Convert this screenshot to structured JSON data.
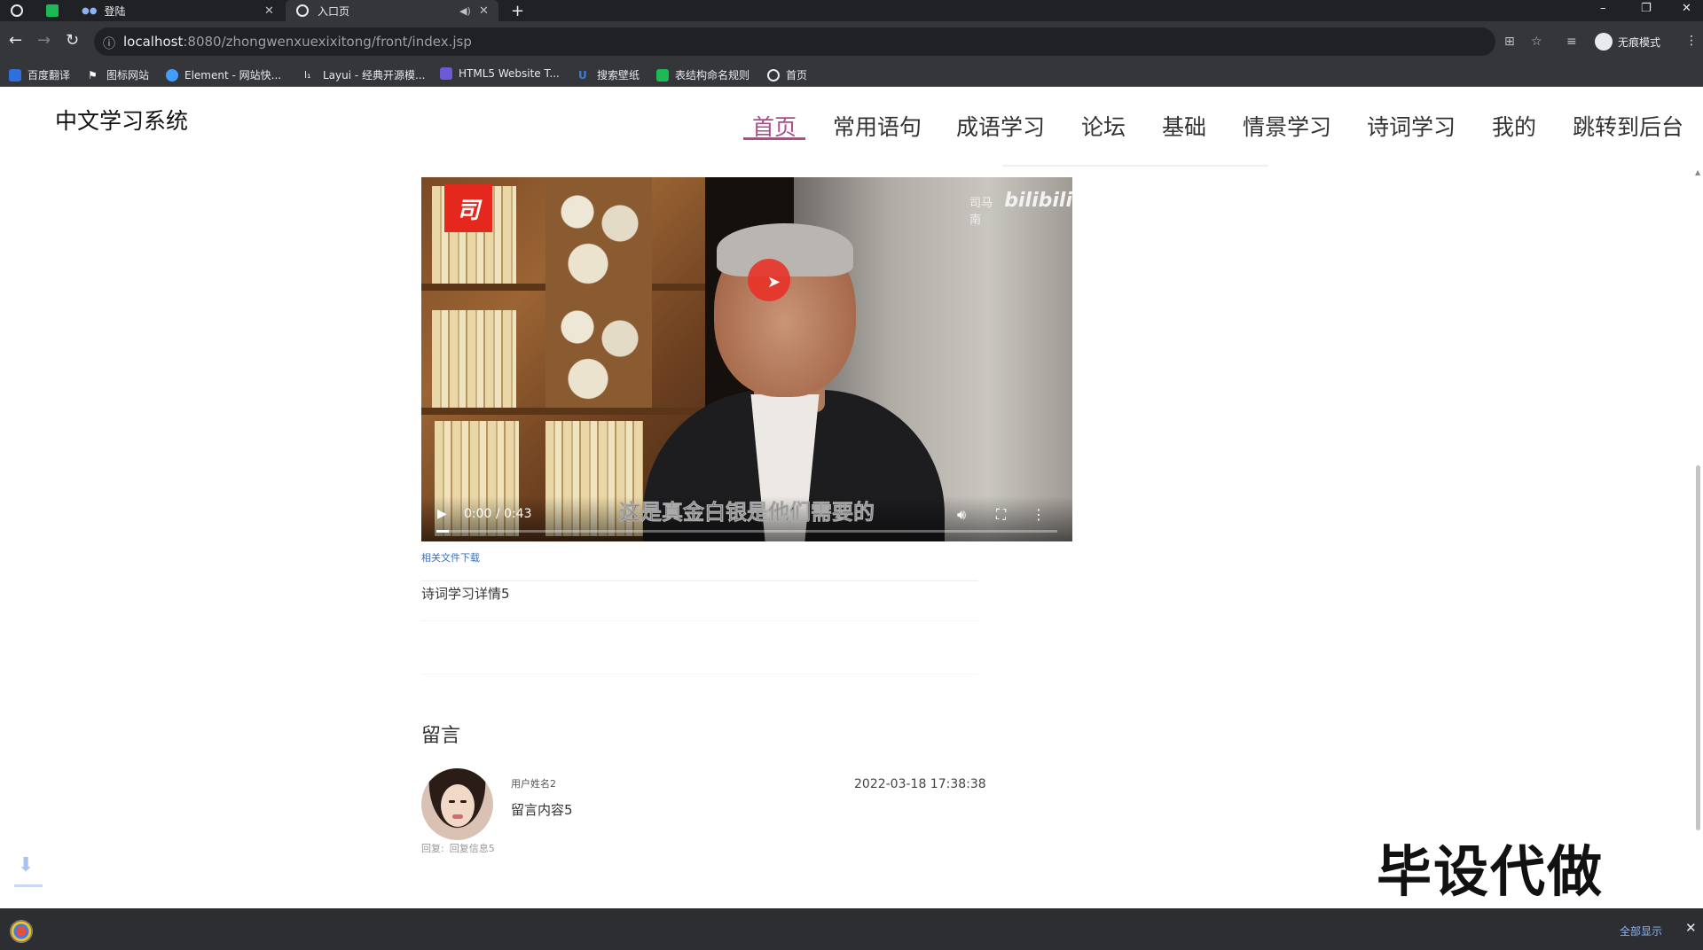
{
  "browser": {
    "tabs": [
      {
        "label": "",
        "icon": "github-icon"
      },
      {
        "label": "",
        "icon": "sheet-icon"
      },
      {
        "label": "登陆",
        "icon": "dots-icon"
      },
      {
        "label": "入口页",
        "icon": "globe-icon",
        "active": true
      }
    ],
    "new_tab": "+",
    "window_controls": [
      "–",
      "❐",
      "✕"
    ],
    "url": {
      "host": "localhost",
      "path": ":8080/zhongwenxuexixitong/front/index.jsp"
    },
    "profile_label": "无痕模式",
    "bookmarks": [
      {
        "label": "百度翻译",
        "color": "#2f6fde"
      },
      {
        "label": "图标网站",
        "color": "#ffffff"
      },
      {
        "label": "Element - 网站快...",
        "color": "#409eff"
      },
      {
        "label": "Layui - 经典开源模...",
        "color": "#e8eaed"
      },
      {
        "label": "HTML5 Website T...",
        "color": "#6b5bd6"
      },
      {
        "label": "搜索壁纸",
        "color": "#3d7ddb"
      },
      {
        "label": "表结构命名规则",
        "color": "#1db954"
      },
      {
        "label": "首页",
        "color": "#e8eaed"
      }
    ]
  },
  "header": {
    "site_title": "中文学习系统",
    "nav": [
      "首页",
      "常用语句",
      "成语学习",
      "论坛",
      "基础",
      "情景学习",
      "诗词学习",
      "我的",
      "跳转到后台"
    ],
    "active_nav": "首页"
  },
  "video": {
    "logo_char": "司",
    "watermark_name": "司马南",
    "watermark_brand": "bilibili",
    "subtitle": "这是真金白银是他们需要的",
    "time": "0:00 / 0:43",
    "progress_fraction": 0.02
  },
  "main": {
    "file_link": "相关文件下载",
    "detail_title": "诗词学习详情5",
    "comments_title": "留言"
  },
  "comment": {
    "user": "用户姓名2",
    "content": "留言内容5",
    "date": "2022-03-18 17:38:38",
    "reply_label": "回复:",
    "reply_text": "回复信息5"
  },
  "overlay": {
    "text": "毕设代做"
  },
  "download_bar": {
    "show_all": "全部显示"
  },
  "colors": {
    "accent": "#b24a8a",
    "link": "#3b6fb5",
    "chrome_dark": "#202124"
  }
}
